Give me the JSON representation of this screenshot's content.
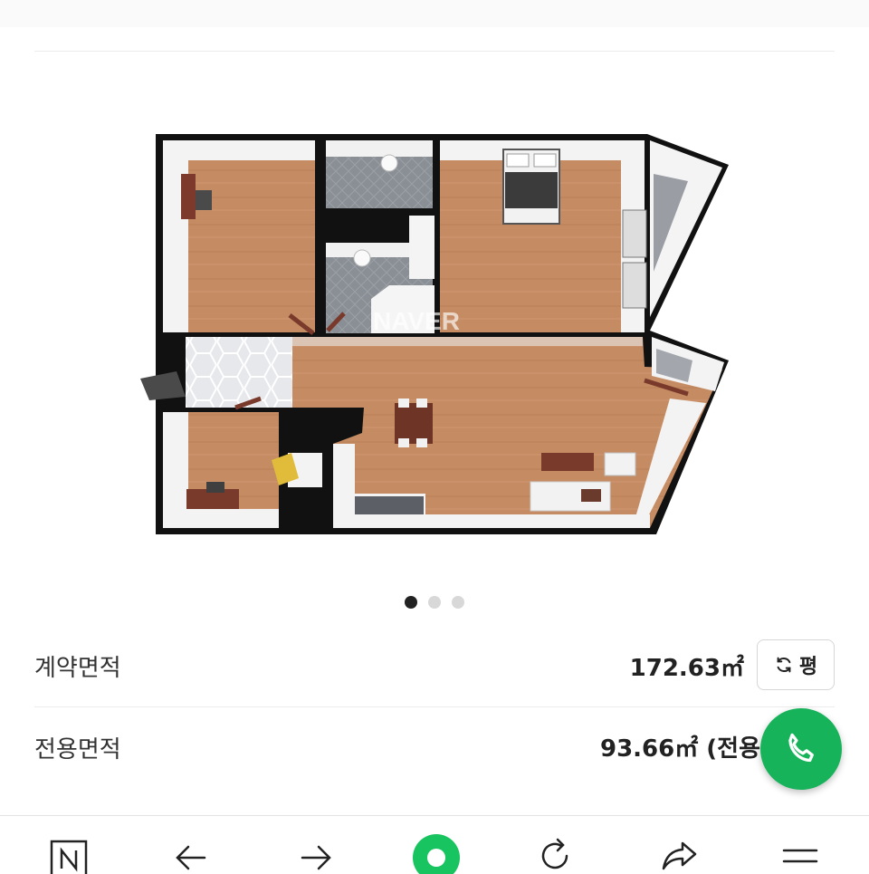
{
  "watermark": "NAVER",
  "carousel": {
    "count": 3,
    "active_index": 0
  },
  "contract_area": {
    "label": "계약면적",
    "value": "172.63㎡",
    "unit_toggle_label": "평"
  },
  "exclusive_area": {
    "label": "전용면적",
    "value": "93.66㎡ (전용률"
  },
  "colors": {
    "call_button": "#17b35a",
    "floor": "#c58c63",
    "wall": "#111111"
  },
  "bottom_nav": {
    "items": [
      "naver-home-icon",
      "back-arrow-icon",
      "forward-arrow-icon",
      "green-dot-icon",
      "refresh-icon",
      "share-icon",
      "menu-icon"
    ]
  }
}
